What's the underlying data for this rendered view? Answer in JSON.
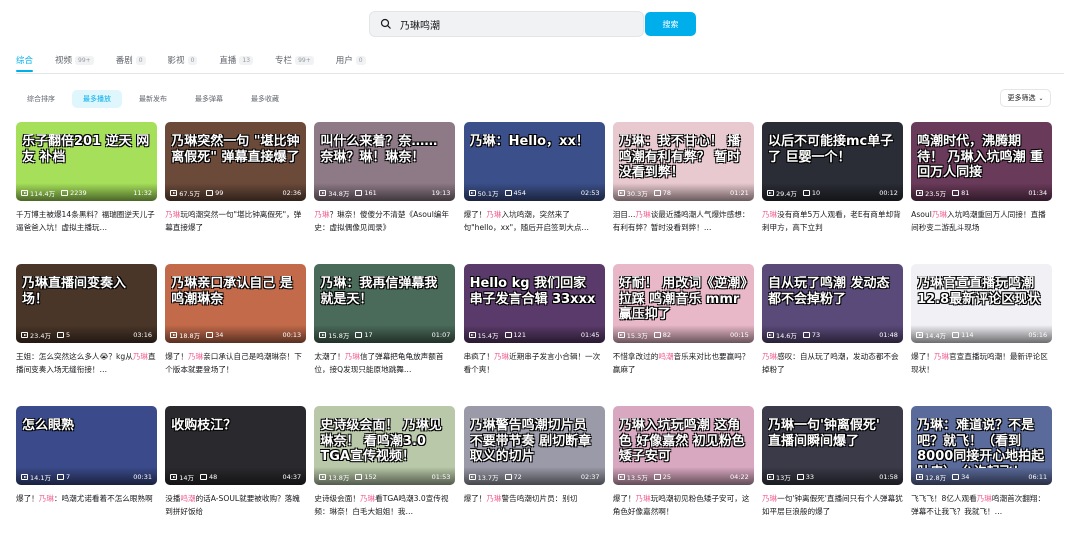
{
  "search": {
    "value": "乃琳鸣潮",
    "button_label": "搜索",
    "icon": "search-icon"
  },
  "tabs": [
    {
      "label": "综合",
      "count": ""
    },
    {
      "label": "视频",
      "count": "99+"
    },
    {
      "label": "番剧",
      "count": "0"
    },
    {
      "label": "影视",
      "count": "0"
    },
    {
      "label": "直播",
      "count": "13"
    },
    {
      "label": "专栏",
      "count": "99+"
    },
    {
      "label": "用户",
      "count": "0"
    }
  ],
  "sorts": [
    "综合排序",
    "最多播放",
    "最新发布",
    "最多弹幕",
    "最多收藏"
  ],
  "more_filter": "更多筛选",
  "colors": {
    "accent": "#00aeec",
    "highlight": "#f25d8e"
  },
  "videos": [
    {
      "overlay": "乐子翻倍201 逆天 网友 补档",
      "views": "114.4万",
      "danmaku": "2239",
      "duration": "11:32",
      "title_a": "千万博主被爆14条黑料？福瑞圈逆天儿子逼爸爸入坑！虚拟主播玩…",
      "title_b": "",
      "title_c": "",
      "bg": "#a6e05a"
    },
    {
      "overlay": "乃琳突然一句 \"堪比钟离假死\" 弹幕直接爆了",
      "views": "67.5万",
      "danmaku": "99",
      "duration": "02:36",
      "title_a": "",
      "title_b": "乃琳",
      "title_c": "玩鸣潮突然一句\"堪比钟离假死\"，弹幕直接爆了",
      "bg": "#6b4a3a"
    },
    {
      "overlay": "叫什么来着？奈……奈琳？琳！琳奈！",
      "views": "34.8万",
      "danmaku": "161",
      "duration": "19:13",
      "title_a": "",
      "title_b": "乃琳",
      "title_c": "？琳奈！傻傻分不清楚《Asoul编年史：虚拟偶像见闻录》",
      "bg": "#8d7a86"
    },
    {
      "overlay": "乃琳：Hello，xx！",
      "views": "50.1万",
      "danmaku": "454",
      "duration": "02:53",
      "title_a": "爆了！",
      "title_b": "乃琳",
      "title_c": "入坑鸣潮，突然来了句\"hello，xx\"，随后开启签到大点…",
      "bg": "#3b4f8a"
    },
    {
      "overlay": "乃琳：我不甘心！ 播鸣潮有利有弊？ 暂时没看到弊！",
      "views": "30.3万",
      "danmaku": "78",
      "duration": "01:21",
      "title_a": "泪目…",
      "title_b": "乃琳",
      "title_c": "谈最近播鸣潮人气爆炸感想：有利有弊？暂时没看到弊！…",
      "bg": "#e8c9cf"
    },
    {
      "overlay": "以后不可能接mc单子了 巨婴一个！",
      "views": "29.4万",
      "danmaku": "10",
      "duration": "00:12",
      "title_a": "",
      "title_b": "乃琳",
      "title_c": "没有商单5万人观看，老E有商单却背刺甲方，高下立判",
      "bg": "#2a2c36"
    },
    {
      "overlay": "鸣潮时代，沸腾期待！ 乃琳入坑鸣潮 重回万人同接",
      "views": "23.5万",
      "danmaku": "81",
      "duration": "01:34",
      "title_a": "Asoul",
      "title_b": "乃琳",
      "title_c": "入坑鸣潮重回万人同接！直播间秒变二游乱斗现场",
      "bg": "#6a3a5a"
    },
    {
      "overlay": "乃琳直播间变奏入场！",
      "views": "23.4万",
      "danmaku": "5",
      "duration": "03:16",
      "title_a": "王姐：怎么突然这么多人😭？kg从",
      "title_b": "乃琳",
      "title_c": "直播间变奏入场无缝衔接！…",
      "bg": "#4a3628"
    },
    {
      "overlay": "乃琳亲口承认自己 是鸣潮琳奈",
      "views": "18.8万",
      "danmaku": "34",
      "duration": "00:13",
      "title_a": "爆了！",
      "title_b": "乃琳",
      "title_c": "亲口承认自己是鸣潮琳奈！下个版本就要登场了！",
      "bg": "#c26a4a"
    },
    {
      "overlay": "乃琳：我再信弹幕我就是天！",
      "views": "15.8万",
      "danmaku": "17",
      "duration": "01:07",
      "title_a": "太潮了！",
      "title_b": "乃琳",
      "title_c": "信了弹幕把龟龟放声额首位，接Q发现只能原地跳舞…",
      "bg": "#4a6a5a"
    },
    {
      "overlay": "Hello kg 我们回家 串子发言合辑 33xxx",
      "views": "15.4万",
      "danmaku": "121",
      "duration": "01:45",
      "title_a": "串疯了！",
      "title_b": "乃琳",
      "title_c": "近期串子发言小合辑！一次看个爽！",
      "bg": "#5a3a6a"
    },
    {
      "overlay": "好耐！ 用改词《逆潮》拉踩 鸣潮音乐 mmr赢压抑了",
      "views": "15.3万",
      "danmaku": "82",
      "duration": "00:15",
      "title_a": "不惜拿改过的",
      "title_b": "鸣潮",
      "title_c": "音乐来对比也要赢吗？赢麻了",
      "bg": "#e8b8c8"
    },
    {
      "overlay": "自从玩了鸣潮 发动态都不会掉粉了",
      "views": "14.6万",
      "danmaku": "73",
      "duration": "01:48",
      "title_a": "",
      "title_b": "乃琳",
      "title_c": "感叹：自从玩了鸣潮，发动态都不会掉粉了",
      "bg": "#5a4a7a"
    },
    {
      "overlay": "乃琳官宣直播玩鸣潮 12.8最新评论区现状",
      "views": "14.4万",
      "danmaku": "114",
      "duration": "05:16",
      "title_a": "爆了！",
      "title_b": "乃琳",
      "title_c": "官宣直播玩鸣潮！最新评论区现状！",
      "bg": "#f0f0f5"
    },
    {
      "overlay": "怎么眼熟",
      "views": "14.1万",
      "danmaku": "7",
      "duration": "00:31",
      "title_a": "爆了！",
      "title_b": "乃琳",
      "title_c": "：鸣潮尤诺看着不怎么眼熟啊",
      "bg": "#3a4a8a"
    },
    {
      "overlay": "收购枝江？",
      "views": "14万",
      "danmaku": "48",
      "duration": "04:37",
      "title_a": "没播",
      "title_b": "鸣潮",
      "title_c": "的话A-SOUL就要被收购？落魄到拼好饭给",
      "bg": "#2a2a2e"
    },
    {
      "overlay": "史诗级会面！ 乃琳见琳奈！ 看鸣潮3.0 TGA宣传视频！",
      "views": "13.8万",
      "danmaku": "152",
      "duration": "01:53",
      "title_a": "史诗级会面！",
      "title_b": "乃琳",
      "title_c": "看TGA鸣潮3.0宣传视频：琳奈！白毛大姐姐！我…",
      "bg": "#b8c8a8"
    },
    {
      "overlay": "乃琳警告鸣潮切片员 不要带节奏 剧切断章取义的切片",
      "views": "13.7万",
      "danmaku": "72",
      "duration": "02:37",
      "title_a": "爆了！",
      "title_b": "乃琳",
      "title_c": "警告鸣潮切片员：别切",
      "bg": "#9a9aa8"
    },
    {
      "overlay": "乃琳入坑玩鸣潮 这角色 好像嘉然 初见粉色矮子安可",
      "views": "13.5万",
      "danmaku": "25",
      "duration": "04:22",
      "title_a": "爆了！",
      "title_b": "乃琳",
      "title_c": "玩鸣潮初见粉色矮子安可，这角色好像嘉然啊！",
      "bg": "#d8a8c0"
    },
    {
      "overlay": "乃琳一句'钟离假死' 直播间瞬间爆了",
      "views": "13万",
      "danmaku": "33",
      "duration": "01:58",
      "title_a": "",
      "title_b": "乃琳",
      "title_c": "一句'钟离假死'直播间只有个人弹幕犹如平层巨浪般的爆了",
      "bg": "#3a3a48"
    },
    {
      "overlay": "乃琳：难道说？不是吧？就飞！（看到8000同接开心地拍起肚皮） 允许起飞！",
      "views": "12.8万",
      "danmaku": "34",
      "duration": "06:11",
      "title_a": "飞飞飞！8亿人观看",
      "title_b": "乃琳",
      "title_c": "鸣潮首次翻翔：弹幕不让我飞？我就飞！…",
      "bg": "#5a6a9a"
    }
  ]
}
